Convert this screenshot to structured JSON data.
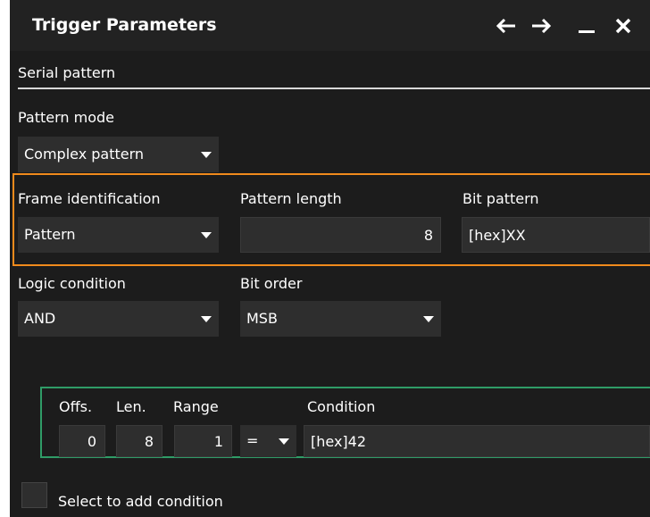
{
  "window": {
    "title": "Trigger Parameters",
    "buttons": [
      "back-arrow-icon",
      "forward-arrow-icon",
      "minimize-icon",
      "close-icon"
    ]
  },
  "section": {
    "title": "Serial pattern"
  },
  "pattern_mode": {
    "label": "Pattern mode",
    "value": "Complex pattern"
  },
  "frame_identification": {
    "label": "Frame identification",
    "value": "Pattern"
  },
  "pattern_length": {
    "label": "Pattern length",
    "value": "8"
  },
  "bit_pattern": {
    "label": "Bit pattern",
    "value": "[hex]XX"
  },
  "logic_condition": {
    "label": "Logic condition",
    "value": "AND"
  },
  "bit_order": {
    "label": "Bit order",
    "value": "MSB"
  },
  "condition_table": {
    "headers": {
      "offs": "Offs.",
      "len": "Len.",
      "range": "Range",
      "condition": "Condition"
    },
    "row": {
      "offs": "0",
      "len": "8",
      "range": "1",
      "operator": "=",
      "condition": "[hex]42"
    }
  },
  "add_condition": {
    "label": "Select to add condition"
  },
  "colors": {
    "frame_highlight": "#f08a1c",
    "condition_highlight": "#2f9c67",
    "background": "#1c1c1c"
  }
}
